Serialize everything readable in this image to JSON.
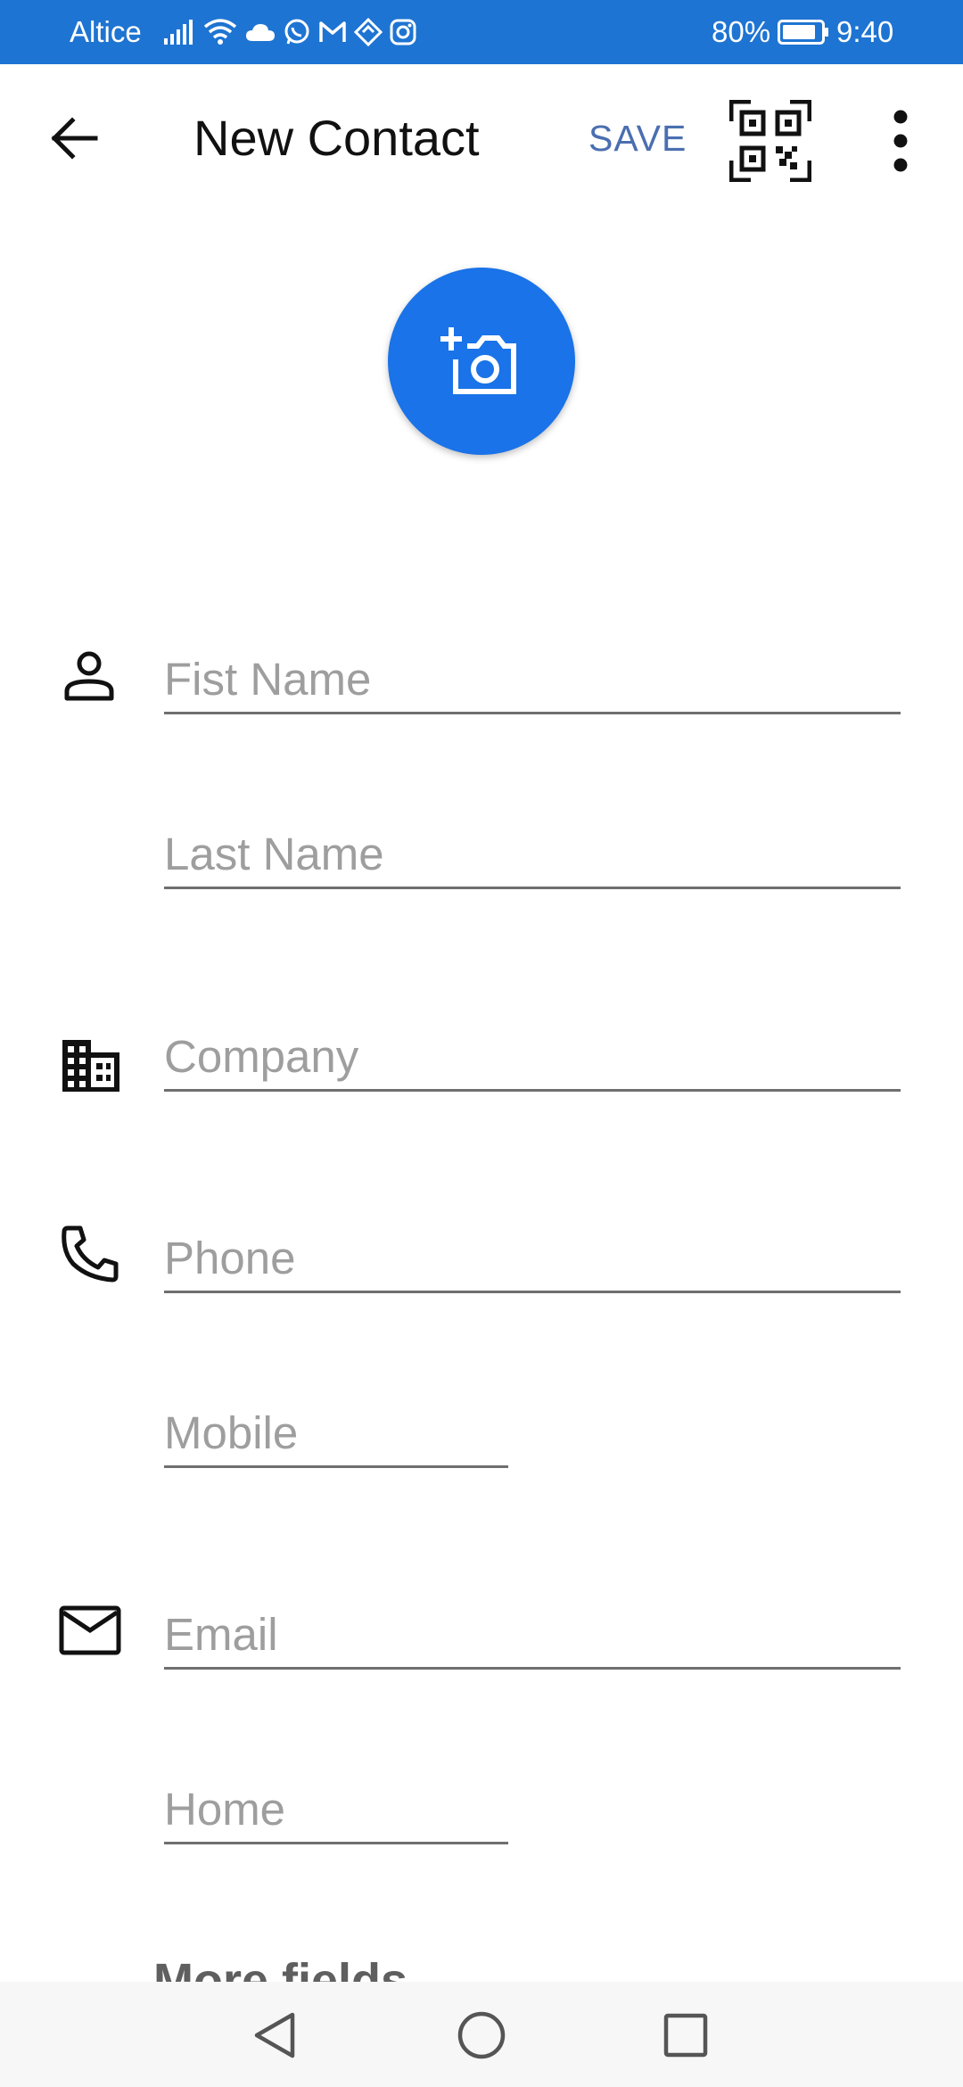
{
  "status_bar": {
    "carrier": "Altice",
    "battery_percent": "80%",
    "time": "9:40",
    "icons": [
      "signal-icon",
      "wifi-icon",
      "cloud-icon",
      "whatsapp-icon",
      "gmail-icon",
      "diamond-app-icon",
      "instagram-icon",
      "battery-icon"
    ]
  },
  "app_bar": {
    "title": "New Contact",
    "save_label": "SAVE",
    "back_icon": "back-arrow-icon",
    "qr_icon": "qr-code-icon",
    "more_icon": "more-vert-icon"
  },
  "photo": {
    "icon": "add-photo-camera-icon",
    "color": "#1a73e8"
  },
  "form": {
    "first_name": {
      "placeholder": "Fist Name",
      "value": ""
    },
    "last_name": {
      "placeholder": "Last Name",
      "value": ""
    },
    "company": {
      "placeholder": "Company",
      "value": ""
    },
    "phone": {
      "placeholder": "Phone",
      "value": ""
    },
    "phone_type": {
      "placeholder": "Mobile",
      "value": ""
    },
    "email": {
      "placeholder": "Email",
      "value": ""
    },
    "email_type": {
      "placeholder": "Home",
      "value": ""
    }
  },
  "more_fields_label": "More fields",
  "nav_bar": {
    "back": "nav-back-icon",
    "home": "nav-home-icon",
    "recents": "nav-recents-icon"
  },
  "colors": {
    "status_bar": "#1e74d2",
    "accent": "#1a73e8",
    "save_text": "#4a6fb0",
    "placeholder": "#9e9e9e",
    "underline": "#6f6f6f"
  }
}
